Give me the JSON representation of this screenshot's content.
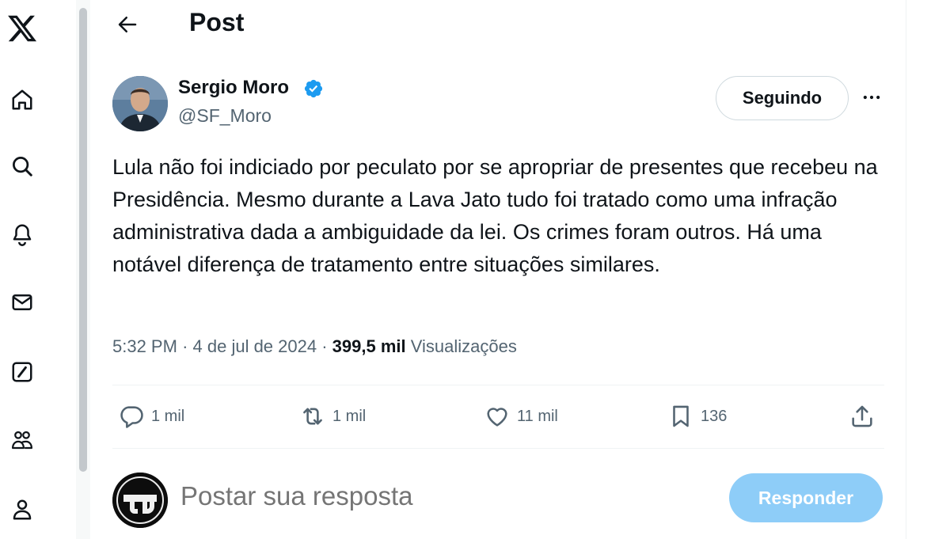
{
  "nav": {
    "items": [
      {
        "icon": "x-logo-icon"
      },
      {
        "icon": "home-icon"
      },
      {
        "icon": "search-icon"
      },
      {
        "icon": "bell-icon"
      },
      {
        "icon": "mail-icon"
      },
      {
        "icon": "grok-icon"
      },
      {
        "icon": "communities-icon"
      },
      {
        "icon": "profile-icon"
      }
    ]
  },
  "header": {
    "title": "Post"
  },
  "post": {
    "author_name": "Sergio Moro",
    "author_handle": "@SF_Moro",
    "follow_label": "Seguindo",
    "text": "Lula não foi indiciado por peculato por se apropriar de presentes que recebeu na Presidência. Mesmo durante a Lava Jato tudo foi tratado como uma infração administrativa dada a ambiguidade da lei. Os crimes foram outros. Há uma notável diferença de tratamento entre situações similares.",
    "time": "5:32 PM",
    "date": "4 de jul de 2024",
    "views_count": "399,5 mil",
    "views_label": "Visualizações",
    "verified_color": "#1d9bf0"
  },
  "actions": {
    "replies": "1 mil",
    "reposts": "1 mil",
    "likes": "11 mil",
    "bookmarks": "136"
  },
  "reply": {
    "placeholder": "Postar sua resposta",
    "button_label": "Responder",
    "button_color": "#8ecdf8"
  }
}
